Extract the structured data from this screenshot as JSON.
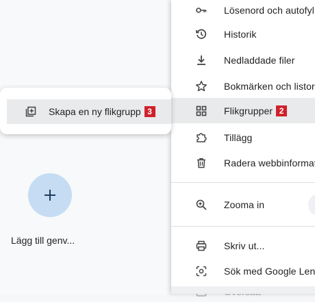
{
  "new_tab_page": {
    "add_shortcut_label": "Lägg till genv..."
  },
  "menu": {
    "items": [
      {
        "label": "Lösenord och autofyll",
        "icon": "key-icon"
      },
      {
        "label": "Historik",
        "icon": "history-icon"
      },
      {
        "label": "Nedladdade filer",
        "icon": "download-icon"
      },
      {
        "label": "Bokmärken och listor",
        "icon": "star-icon"
      },
      {
        "label": "Flikgrupper",
        "icon": "tab-groups-icon",
        "badge": "2"
      },
      {
        "label": "Tillägg",
        "icon": "extension-icon"
      },
      {
        "label": "Radera webbinformation",
        "icon": "trash-icon"
      },
      {
        "label": "Zooma in",
        "icon": "zoom-icon"
      },
      {
        "label": "Skriv ut...",
        "icon": "print-icon"
      },
      {
        "label": "Sök med Google Lens",
        "icon": "lens-icon"
      },
      {
        "label": "Översätt",
        "icon": "translate-icon"
      }
    ]
  },
  "submenu": {
    "item": {
      "label": "Skapa en ny flikgrupp",
      "icon": "new-tab-group-icon",
      "badge": "3"
    }
  },
  "colors": {
    "badge": "#d0212b",
    "hover": "#e9eaec",
    "shortcut_circle": "#c5dcf3",
    "plus": "#1f3a60"
  }
}
